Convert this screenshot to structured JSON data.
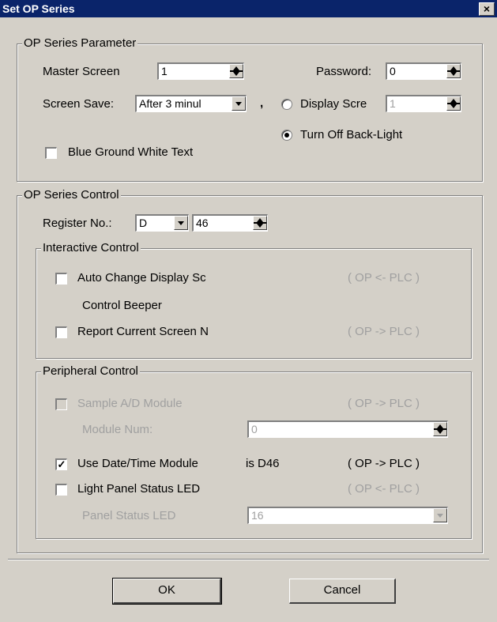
{
  "window": {
    "title": "Set OP Series",
    "close_label": "×"
  },
  "op_param": {
    "legend": "OP Series Parameter",
    "master_screen_label": "Master Screen",
    "master_screen_value": "1",
    "password_label": "Password:",
    "password_value": "0",
    "screen_save_label": "Screen Save:",
    "screen_save_value": "After 3 minul",
    "comma": ",",
    "display_screen_label": "Display Scre",
    "display_screen_value": "1",
    "turn_off_label": "Turn Off Back-Light",
    "blue_ground_label": "Blue Ground White Text"
  },
  "op_control": {
    "legend": "OP Series Control",
    "register_label": "Register No.:",
    "register_type": "D",
    "register_number": "46",
    "interactive": {
      "legend": "Interactive Control",
      "auto_change_label": "Auto Change Display Sc",
      "auto_change_dir": "( OP <- PLC )",
      "control_beeper_label": "Control Beeper",
      "report_label": "Report Current Screen N",
      "report_dir": "( OP -> PLC )"
    },
    "peripheral": {
      "legend": "Peripheral Control",
      "sample_ad_label": "Sample A/D Module",
      "sample_ad_dir": "( OP -> PLC )",
      "module_num_label": "Module Num:",
      "module_num_value": "0",
      "date_time_label": "Use Date/Time Module",
      "date_time_reg": "is D46",
      "date_time_dir": "( OP -> PLC )",
      "light_panel_label": "Light Panel Status LED",
      "light_panel_dir": "( OP <- PLC )",
      "panel_led_label": "Panel Status LED",
      "panel_led_value": "16"
    }
  },
  "buttons": {
    "ok": "OK",
    "cancel": "Cancel"
  }
}
